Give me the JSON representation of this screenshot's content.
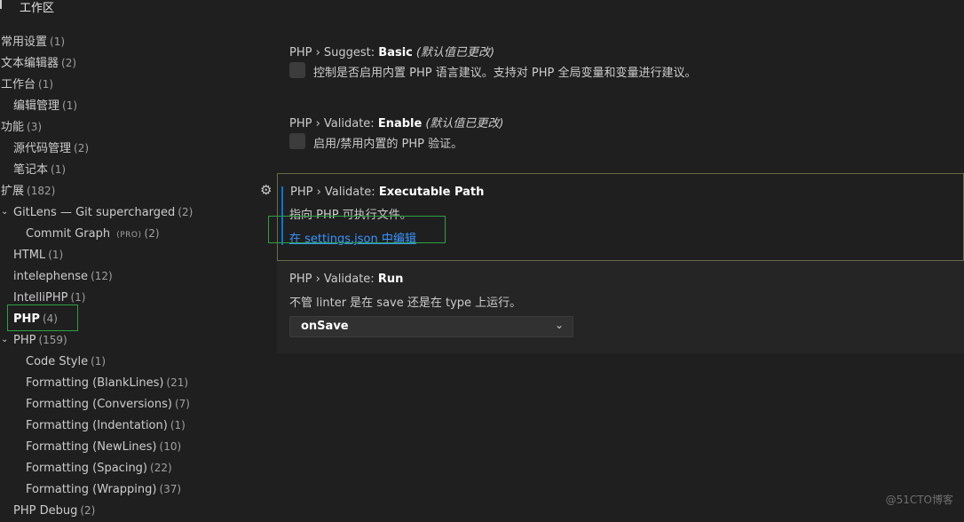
{
  "header": {
    "tab_label": "工作区"
  },
  "toc": {
    "items": [
      {
        "label": "常用设置",
        "count": "(1)"
      },
      {
        "label": "文本编辑器",
        "count": "(2)"
      },
      {
        "label": "工作台",
        "count": "(1)"
      },
      {
        "label": "编辑管理",
        "count": "(1)"
      },
      {
        "label": "功能",
        "count": "(3)"
      },
      {
        "label": "源代码管理",
        "count": "(2)"
      },
      {
        "label": "笔记本",
        "count": "(1)"
      },
      {
        "label": "扩展",
        "count": "(182)"
      },
      {
        "label": "GitLens — Git supercharged",
        "count": "(2)"
      },
      {
        "label": "Commit Graph",
        "badge": "(PRO)",
        "count": "(2)"
      },
      {
        "label": "HTML",
        "count": "(1)"
      },
      {
        "label": "intelephense",
        "count": "(12)"
      },
      {
        "label": "IntelliPHP",
        "count": "(1)"
      },
      {
        "label": "PHP",
        "count": "(4)"
      },
      {
        "label": "PHP",
        "count": "(159)"
      },
      {
        "label": "Code Style",
        "count": "(1)"
      },
      {
        "label": "Formatting (BlankLines)",
        "count": "(21)"
      },
      {
        "label": "Formatting (Conversions)",
        "count": "(7)"
      },
      {
        "label": "Formatting (Indentation)",
        "count": "(1)"
      },
      {
        "label": "Formatting (NewLines)",
        "count": "(10)"
      },
      {
        "label": "Formatting (Spacing)",
        "count": "(22)"
      },
      {
        "label": "Formatting (Wrapping)",
        "count": "(37)"
      },
      {
        "label": "PHP Debug",
        "count": "(2)"
      }
    ]
  },
  "settings": {
    "suggest_basic": {
      "category": "PHP › Suggest: ",
      "key": "Basic",
      "modified": "(默认值已更改)",
      "description": "控制是否启用内置 PHP 语言建议。支持对 PHP 全局变量和变量进行建议。"
    },
    "validate_enable": {
      "category": "PHP › Validate: ",
      "key": "Enable",
      "modified": "(默认值已更改)",
      "description": "启用/禁用内置的 PHP 验证。"
    },
    "executable_path": {
      "category": "PHP › Validate: ",
      "key": "Executable Path",
      "description": "指向 PHP 可执行文件。",
      "link": "在 settings.json 中编辑"
    },
    "validate_run": {
      "category": "PHP › Validate: ",
      "key": "Run",
      "description": "不管 linter 是在 save 还是在 type 上运行。",
      "value": "onSave"
    }
  },
  "watermark": "@51CTO博客",
  "colors": {
    "accent_link": "#3794ff",
    "highlight_box": "#2ea043",
    "background": "#1f1f1f"
  }
}
